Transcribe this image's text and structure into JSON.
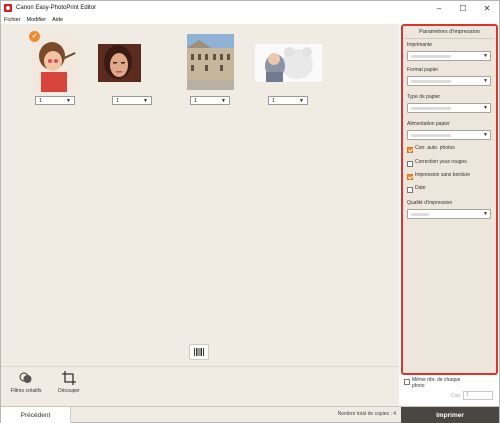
{
  "window": {
    "title": "Canon Easy-PhotoPrint Editor"
  },
  "menu": [
    "Fichier",
    "Modifier",
    "Aide"
  ],
  "photos": [
    {
      "copies": "1",
      "selected": true,
      "desc": "child-painting"
    },
    {
      "copies": "1",
      "selected": false,
      "desc": "woman-portrait"
    },
    {
      "copies": "1",
      "selected": false,
      "desc": "building"
    },
    {
      "copies": "1",
      "selected": false,
      "desc": "baby-with-bear"
    }
  ],
  "tools": {
    "filters_label": "Filtres créatifs",
    "crop_label": "Découper"
  },
  "footer": {
    "prev_label": "Précédent",
    "total_label": "Nombre total de copies : 4",
    "print_label": "Imprimer"
  },
  "panel": {
    "title": "Paramètres d'impression",
    "printer_label": "Imprimante",
    "paper_size_label": "Format papier",
    "paper_type_label": "Type de papier",
    "paper_source_label": "Alimentation papier",
    "auto_fix_label": "Corr. auto. photos",
    "redeye_label": "Correction yeux rouges",
    "borderless_label": "Impression sans bordure",
    "date_label": "Date",
    "quality_label": "Qualité d'impression",
    "same_nb_label": "Même nbr. de chaque photo",
    "copies_label": "Cop."
  },
  "colors": {
    "accent": "#f08a2e",
    "highlight": "#e0322d",
    "print_bg": "#4a4743",
    "workspace_bg": "#f0ece4"
  }
}
